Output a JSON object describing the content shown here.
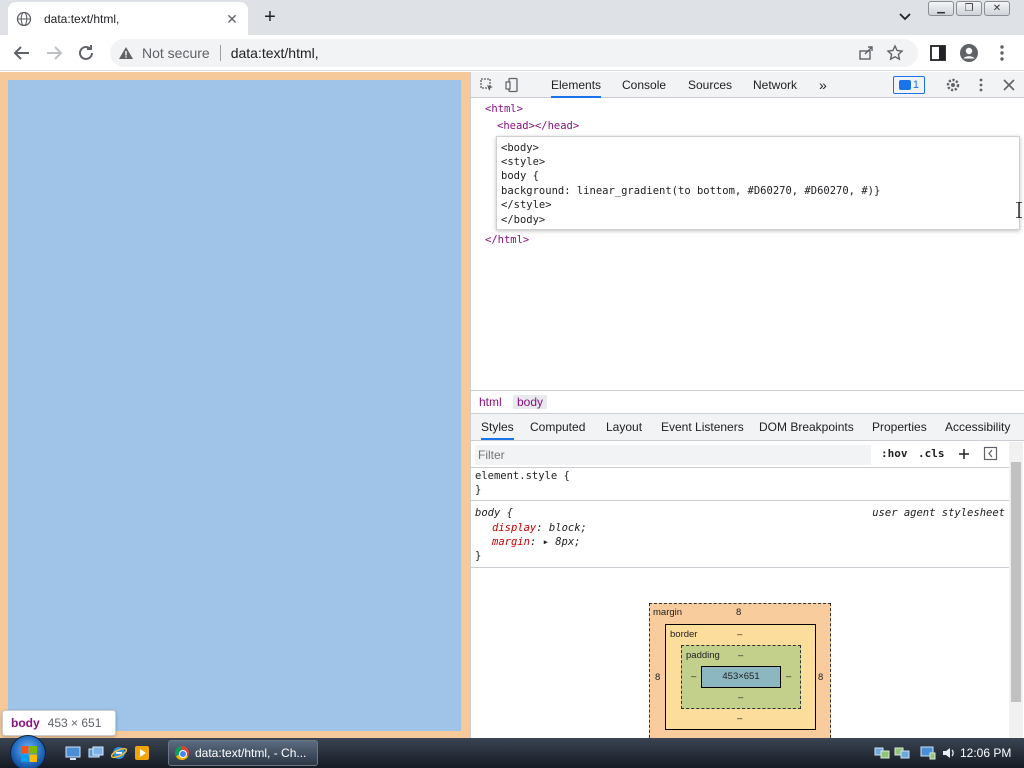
{
  "browser": {
    "tab_title": "data:text/html,",
    "omnibox_security": "Not secure",
    "omnibox_url": "data:text/html,"
  },
  "page_tooltip": {
    "tag": "body",
    "dims": "453 × 651"
  },
  "devtools": {
    "tabs": [
      "Elements",
      "Console",
      "Sources",
      "Network"
    ],
    "more": "»",
    "issues_count": "1",
    "elements": {
      "html_open": "<html>",
      "head": "<head></head>",
      "edit_lines": [
        "<body>",
        "<style>",
        "body {",
        "background: linear_gradient(to bottom, #D60270, #D60270, #)}",
        "</style>",
        "</body>"
      ],
      "html_close": "</html>"
    },
    "breadcrumbs": [
      "html",
      "body"
    ],
    "sub_tabs": [
      "Styles",
      "Computed",
      "Layout",
      "Event Listeners",
      "DOM Breakpoints",
      "Properties",
      "Accessibility"
    ],
    "filter_placeholder": "Filter",
    "hov": ":hov",
    "cls": ".cls",
    "styles": {
      "element_style_open": "element.style {",
      "close": "}",
      "body_selector": "body {",
      "source": "user agent stylesheet",
      "prop1": "display",
      "val1": "block;",
      "prop2": "margin",
      "val2": "8px;"
    },
    "box_model": {
      "margin_label": "margin",
      "margin_val": "8",
      "border_label": "border",
      "border_val": "–",
      "padding_label": "padding",
      "padding_val": "–",
      "content": "453×651",
      "left_margin": "8",
      "right_margin": "8",
      "dash": "–"
    }
  },
  "taskbar": {
    "task_label": "data:text/html, - Ch...",
    "clock": "12:06 PM"
  }
}
